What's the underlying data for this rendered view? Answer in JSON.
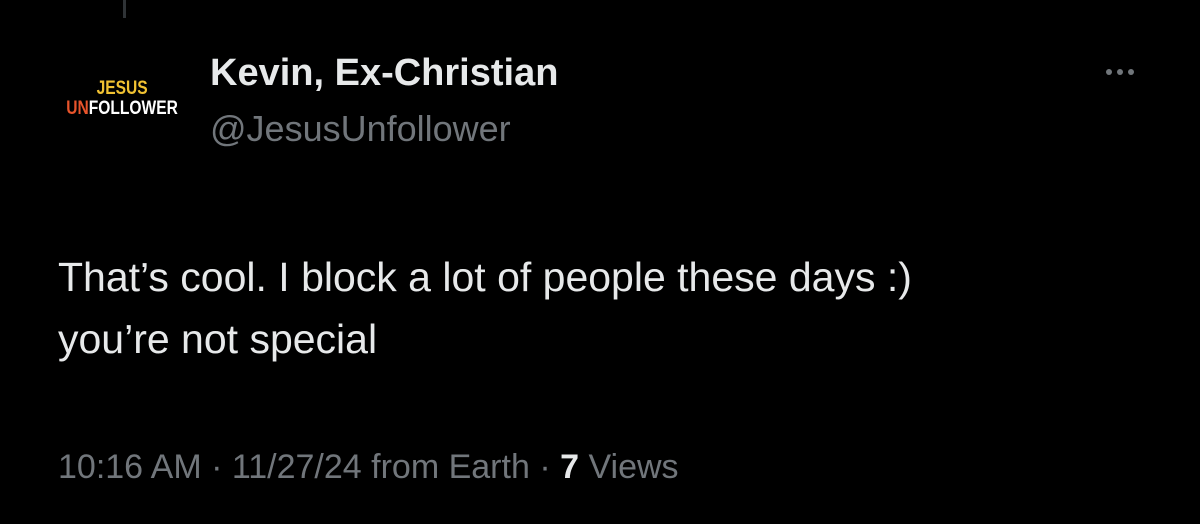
{
  "avatar": {
    "line1": "JESUS",
    "line2_prefix": "UN",
    "line2_rest": "FOLLOWER"
  },
  "author": {
    "display_name": "Kevin, Ex-Christian",
    "handle": "@JesusUnfollower"
  },
  "more_icon": "more-horizontal-icon",
  "tweet": {
    "line1": "That’s cool. I block a lot of people these days :)",
    "line2": "you’re not special"
  },
  "meta": {
    "time": "10:16 AM",
    "separator1": " · ",
    "date": "11/27/24",
    "source": " from Earth",
    "separator2": " · ",
    "views_count": "7",
    "views_label": " Views"
  },
  "colors": {
    "background": "#000000",
    "primary_text": "#e7e9ea",
    "secondary_text": "#71767b",
    "logo_yellow": "#f1c232",
    "logo_orange": "#e8542b"
  }
}
